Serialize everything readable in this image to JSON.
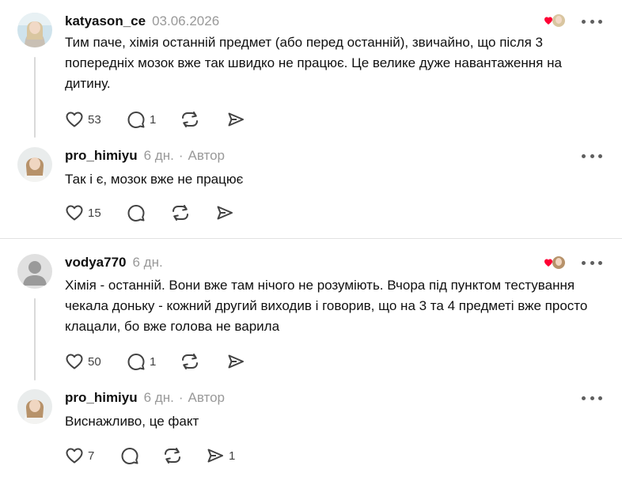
{
  "comments": [
    {
      "username": "katyason_ce",
      "time": "03.06.2026",
      "text": "Тим паче, хімія останній предмет (або перед останній), звичайно, що після 3 попередніх мозок вже так швидко не працює. Це велике дуже навантаження на дитину.",
      "avatar_icon": "avatar-photo-icon",
      "likes": "53",
      "replies": "1",
      "reposts": "",
      "shares": "",
      "liked_by_author": true,
      "reply": {
        "username": "pro_himiyu",
        "time": "6 дн.",
        "separator": "·",
        "role": "Автор",
        "text": "Так і є, мозок вже не працює",
        "likes": "15",
        "replies": "",
        "reposts": "",
        "shares": ""
      }
    },
    {
      "username": "vodya770",
      "time": "6 дн.",
      "text": "Хімія - останній. Вони вже там нічого не розуміють. Вчора під пунктом тестування чекала доньку - кожний другий виходив і говорив, що на 3 та 4 предметі вже просто клацали, бо вже голова не варила",
      "avatar_icon": "default-avatar-icon",
      "likes": "50",
      "replies": "1",
      "reposts": "",
      "shares": "",
      "liked_by_author": true,
      "reply": {
        "username": "pro_himiyu",
        "time": "6 дн.",
        "separator": "·",
        "role": "Автор",
        "text": "Виснажливо, це факт",
        "likes": "7",
        "replies": "",
        "reposts": "",
        "shares": "1"
      }
    }
  ],
  "icons": {
    "like": "heart-icon",
    "reply": "speech-bubble-icon",
    "repost": "repost-arrows-icon",
    "share": "send-icon",
    "more": "more-dots-icon",
    "liked_by_author": "author-liked-heart-icon"
  },
  "colors": {
    "text": "#101010",
    "muted": "#999999",
    "icon": "#424242",
    "heart": "#ff0034",
    "divider": "#e2e2e2"
  }
}
